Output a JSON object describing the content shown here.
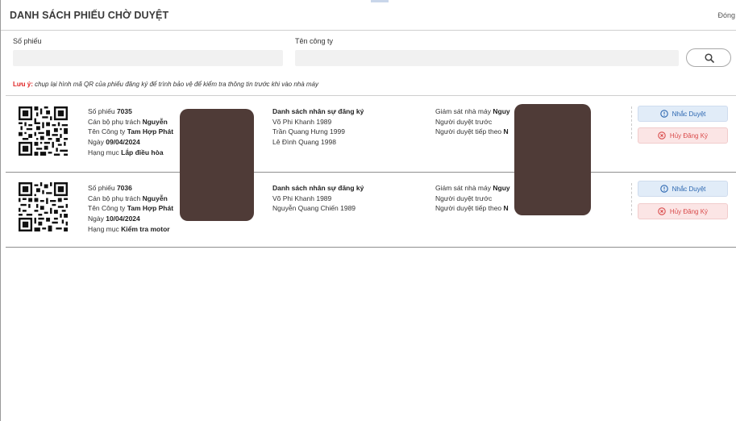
{
  "header": {
    "title": "DANH SÁCH PHIẾU CHỜ DUYỆT",
    "close_label": "Đóng"
  },
  "filters": {
    "so_phieu_label": "Số phiếu",
    "so_phieu_value": "",
    "cong_ty_label": "Tên công ty",
    "cong_ty_value": "",
    "search_icon": "search-icon"
  },
  "note": {
    "prefix": "Lưu ý:",
    "text": " chụp lại hình mã QR của phiếu đăng ký để trình bảo vệ để kiểm tra thông tin trước khi vào nhà máy"
  },
  "colors": {
    "warn": "#e02424",
    "remind_bg": "#e1ecf8",
    "remind_text": "#2b66b0",
    "cancel_bg": "#fbe5e5",
    "cancel_text": "#d94b4b",
    "redaction": "#4f3b37"
  },
  "records": [
    {
      "so_phieu_label": "Số phiếu",
      "so_phieu": "7035",
      "can_bo_label": "Cán bộ phụ trách",
      "can_bo": "Nguyễn",
      "cong_ty_label": "Tên Công ty",
      "cong_ty": "Tam Hợp Phát",
      "ngay_label": "Ngày",
      "ngay": "09/04/2024",
      "hang_muc_label": "Hạng mục",
      "hang_muc": "Lắp điều hòa",
      "nhan_su_title": "Danh sách nhân sự đăng ký",
      "nhan_su": [
        "Võ Phi Khanh 1989",
        "Trần Quang Hưng 1999",
        "Lê Đình Quang 1998"
      ],
      "giam_sat_label": "Giám sát nhà máy",
      "giam_sat": "Nguy",
      "duyet_truoc_label": "Người duyệt trước",
      "duyet_tiep_label": "Người duyệt tiếp theo",
      "duyet_tiep": "N",
      "remind_label": "Nhắc Duyệt",
      "cancel_label": "Hủy Đăng Ký"
    },
    {
      "so_phieu_label": "Số phiếu",
      "so_phieu": "7036",
      "can_bo_label": "Cán bộ phụ trách",
      "can_bo": "Nguyễn",
      "cong_ty_label": "Tên Công ty",
      "cong_ty": "Tam Hợp Phát",
      "ngay_label": "Ngày",
      "ngay": "10/04/2024",
      "hang_muc_label": "Hạng mục",
      "hang_muc": "Kiểm tra motor",
      "nhan_su_title": "Danh sách nhân sự đăng ký",
      "nhan_su": [
        "Võ Phi Khanh 1989",
        "Nguyễn Quang Chiến 1989"
      ],
      "giam_sat_label": "Giám sát nhà máy",
      "giam_sat": "Nguy",
      "duyet_truoc_label": "Người duyệt trước",
      "duyet_tiep_label": "Người duyệt tiếp theo",
      "duyet_tiep": "N",
      "remind_label": "Nhắc Duyệt",
      "cancel_label": "Hủy Đăng Ký"
    }
  ]
}
